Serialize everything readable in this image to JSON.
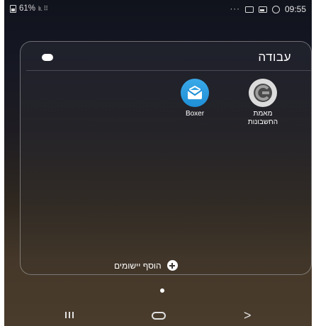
{
  "status_bar": {
    "battery_text": "61%",
    "signal_text": "lı. ⠿",
    "more_indicator": "···",
    "time": "09:55",
    "icons": [
      "battery-icon",
      "signal-icon",
      "more-notifications-icon",
      "message-icon",
      "gallery-icon",
      "whatsapp-icon"
    ]
  },
  "folder": {
    "title": "עבודה",
    "color_dot": "#ffffff",
    "apps": [
      {
        "label": "Boxer",
        "icon": "boxer-envelope-icon",
        "color": "#2196e0"
      },
      {
        "label": "מאמת החשבונות",
        "icon": "authenticator-icon",
        "color": "#dcdcdc"
      }
    ],
    "add_apps_label": "הוסף יישומים"
  },
  "nav_bar": {
    "recents": "recents-icon",
    "home": "home-icon",
    "back": "back-icon",
    "back_glyph": ">"
  }
}
